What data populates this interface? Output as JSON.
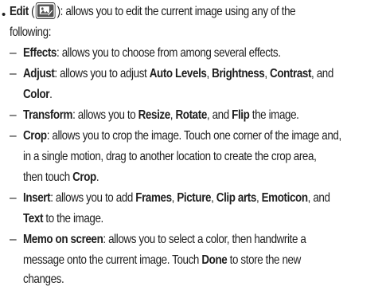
{
  "bullet_symbol": "•",
  "dash_symbol": "–",
  "edit": {
    "label": "Edit",
    "open_paren": " (",
    "close_paren": "): allows you to edit the current image using any of the",
    "line2": "following:",
    "icon": "image-edit-icon"
  },
  "items": [
    {
      "term": "Effects",
      "rest": ": allows you to choose from among several effects."
    },
    {
      "term": "Adjust",
      "seg1": ": allows you to adjust ",
      "b1": "Auto Levels",
      "s2": ", ",
      "b2": "Brightness",
      "s3": ", ",
      "b3": "Contrast",
      "s4": ", and",
      "b4": "Color",
      "s5": "."
    },
    {
      "term": "Transform",
      "seg1": ": allows you to ",
      "b1": "Resize",
      "s2": ", ",
      "b2": "Rotate",
      "s3": ", and ",
      "b3": "Flip",
      "s4": " the image."
    },
    {
      "term": "Crop",
      "line1": ": allows you to crop the image. Touch one corner of the image and,",
      "line2": "in a single motion, drag to another location to create the crop area,",
      "line3a": "then touch ",
      "line3b": "Crop",
      "line3c": "."
    },
    {
      "term": "Insert",
      "seg1": ": allows you to add ",
      "b1": "Frames",
      "s2": ", ",
      "b2": "Picture",
      "s3": ", ",
      "b3": "Clip arts",
      "s4": ", ",
      "b4": "Emoticon",
      "s5": ", and",
      "b5": "Text",
      "s6": " to the image."
    },
    {
      "term": "Memo on screen",
      "line1": ": allows you to select a color, then handwrite a",
      "line2": "message onto the current image. Touch ",
      "b1": "Done",
      "line2b": " to store the new",
      "line3": "changes."
    }
  ]
}
